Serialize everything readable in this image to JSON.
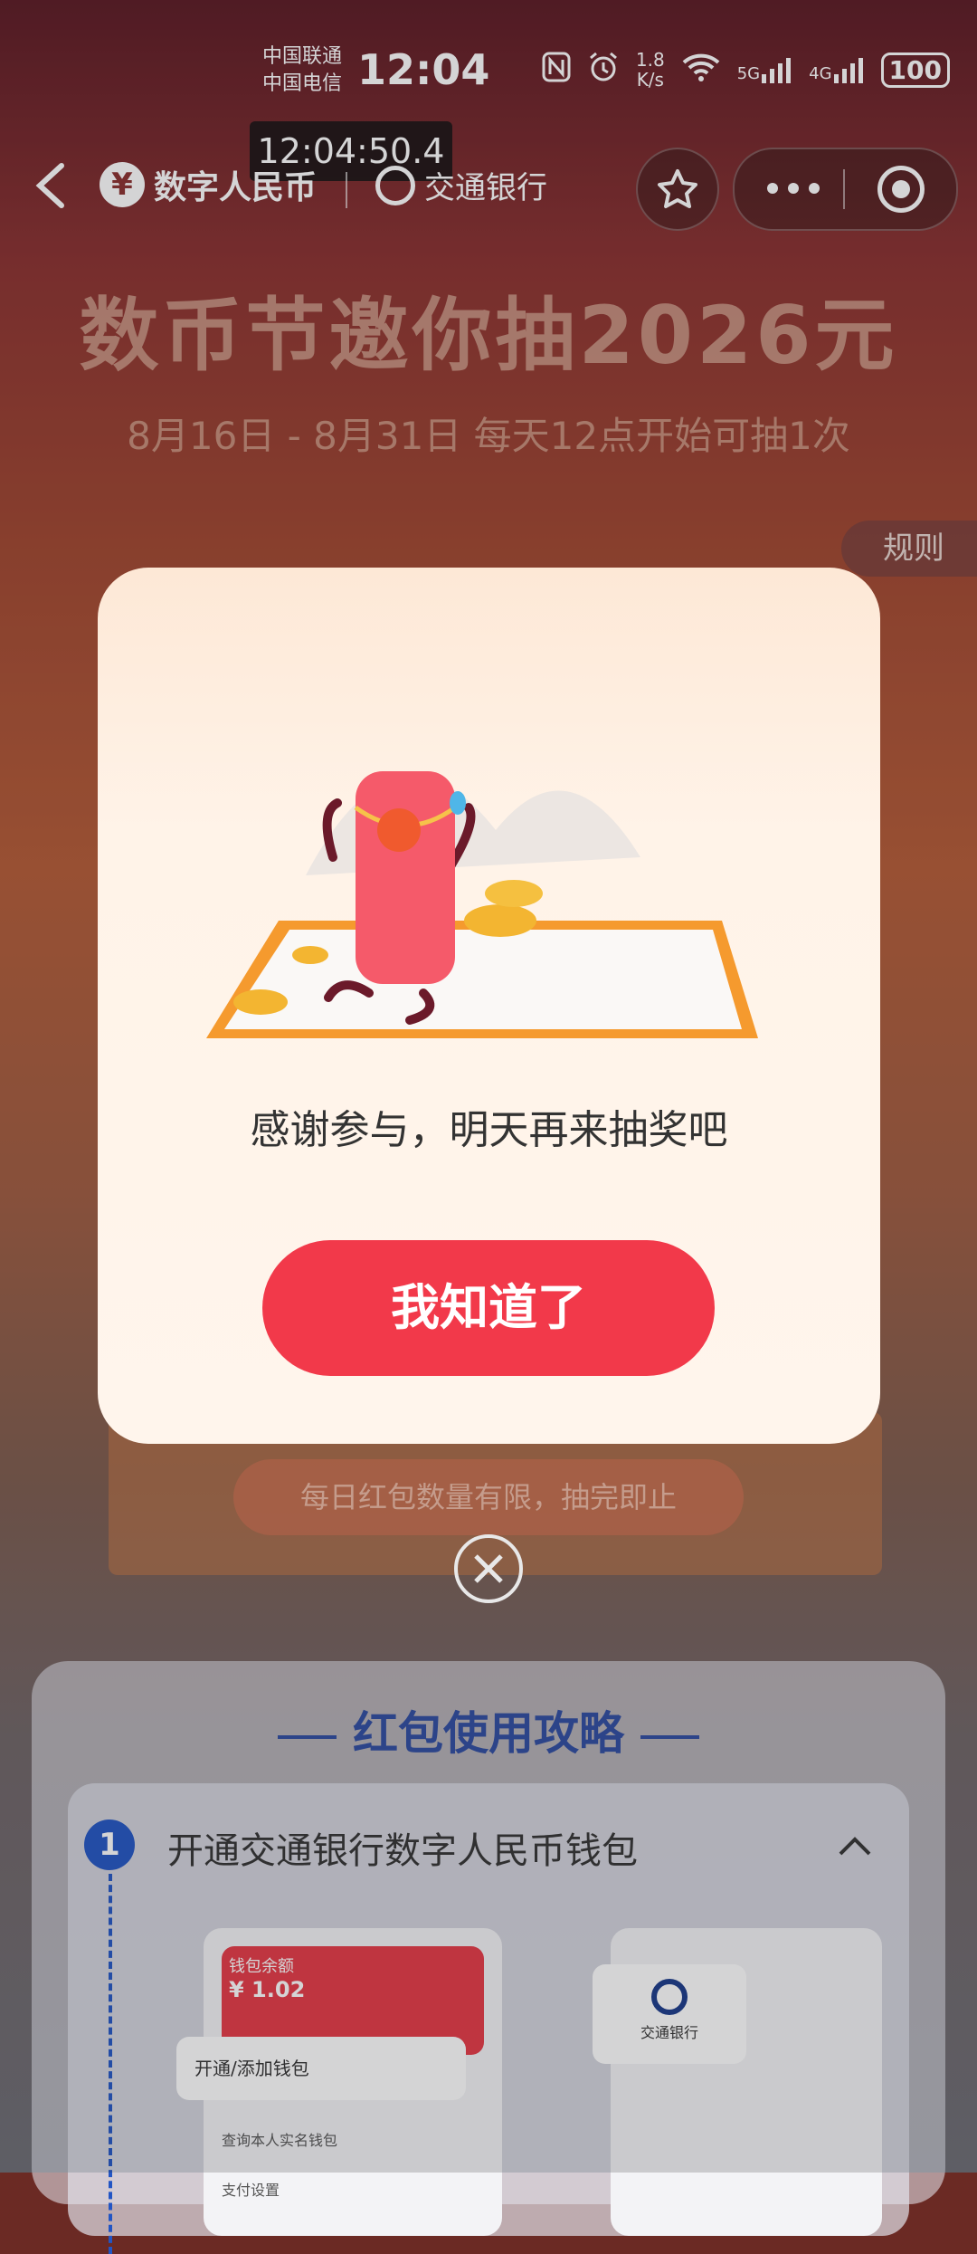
{
  "status_bar": {
    "carrier_1": "中国联通",
    "carrier_2": "中国电信",
    "time": "12:04",
    "net_speed_value": "1.8",
    "net_speed_unit": "K/s",
    "signal_1": "5G",
    "signal_2": "4G",
    "battery": "100"
  },
  "timestamp_overlay": "12:04:50.4",
  "nav": {
    "logo_left_text": "数字人民币",
    "logo_right_text": "交通银行"
  },
  "banner": {
    "headline": "数币节邀你抽2026元",
    "subline": "8月16日 - 8月31日 每天12点开始可抽1次",
    "rules_label": "规则"
  },
  "background": {
    "limit_notice": "每日红包数量有限，抽完即止",
    "guide_title": "红包使用攻略",
    "step_number": "1",
    "step_text": "开通交通银行数字人民币钱包",
    "mock_wallet_label": "钱包余额",
    "mock_amount": "¥ 1.02",
    "mock_open_wallet": "开通/添加钱包",
    "mock_row_2": "查询本人实名钱包",
    "mock_row_3": "支付设置",
    "mock_bank_label": "交通银行"
  },
  "modal": {
    "message": "感谢参与，明天再来抽奖吧",
    "confirm_button": "我知道了"
  },
  "colors": {
    "accent_red": "#f2394a",
    "guide_blue": "#2d4ba0"
  }
}
